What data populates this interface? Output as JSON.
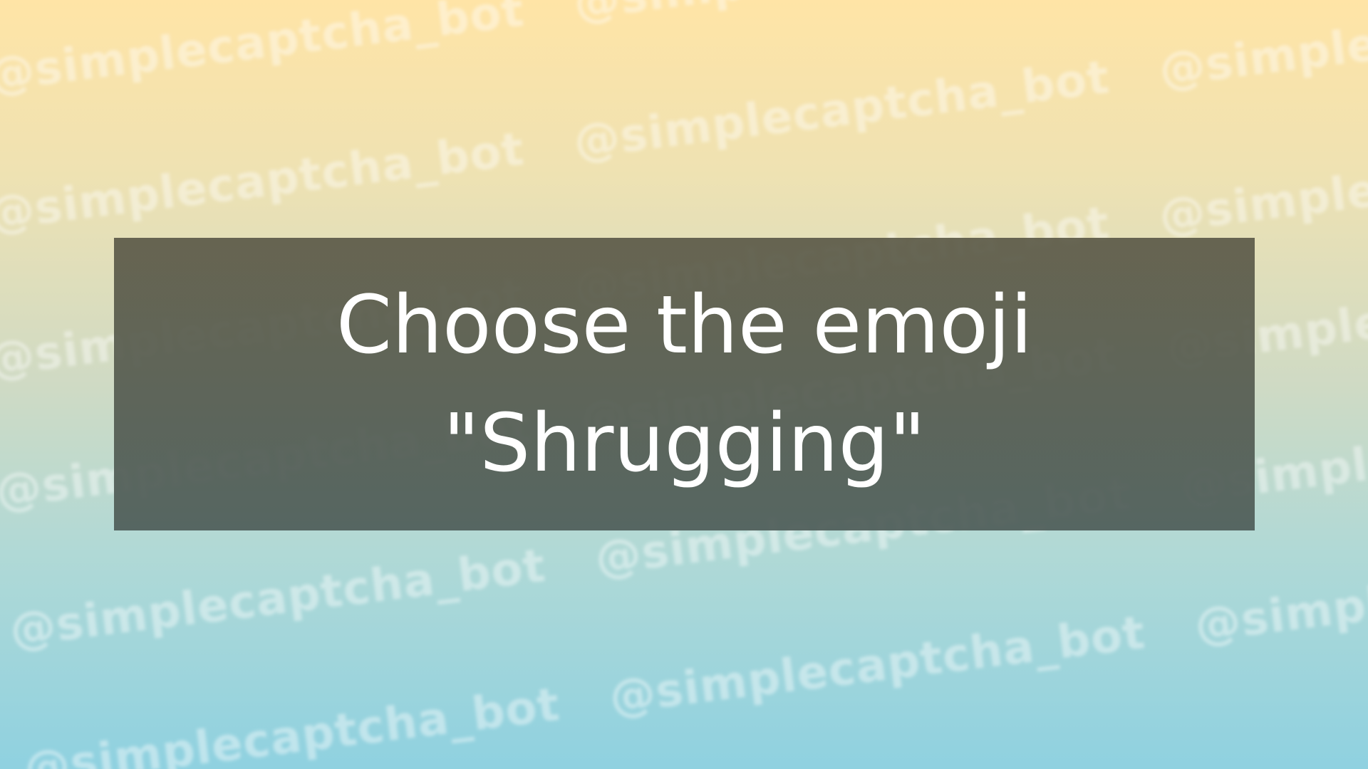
{
  "watermark": {
    "text": "@simplecaptcha_bot"
  },
  "prompt": {
    "line1": "Choose the emoji",
    "line2": "\"Shrugging\""
  },
  "colors": {
    "background_top": "#ffe4a6",
    "background_bottom": "#8fd1e0",
    "panel": "#5f6a5e",
    "text": "#ffffff"
  }
}
